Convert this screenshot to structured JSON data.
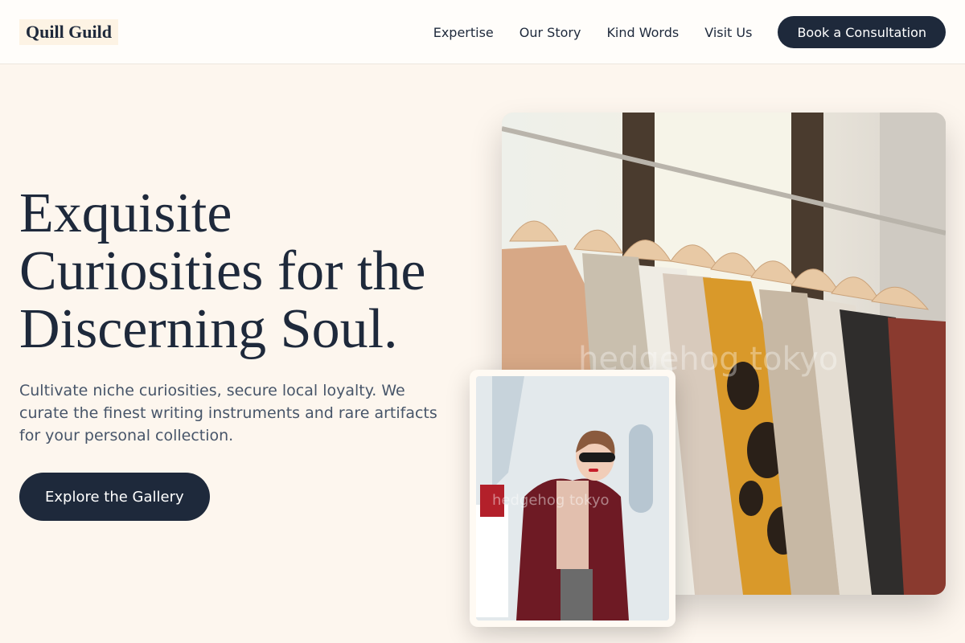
{
  "header": {
    "logo": "Quill Guild",
    "nav": [
      "Expertise",
      "Our Story",
      "Kind Words",
      "Visit Us"
    ],
    "cta": "Book a Consultation"
  },
  "hero": {
    "title": "Exquisite Curiosities for the Discerning Soul.",
    "description": "Cultivate niche curiosities, secure local loyalty. We curate the finest writing instruments and rare artifacts for your personal collection.",
    "button": "Explore the Gallery"
  },
  "images": {
    "main_watermark": "hedgehog tokyo",
    "inset_watermark": "hedgehog tokyo"
  },
  "colors": {
    "background": "#fdf6ee",
    "primary": "#1e293b",
    "text_muted": "#475569"
  }
}
